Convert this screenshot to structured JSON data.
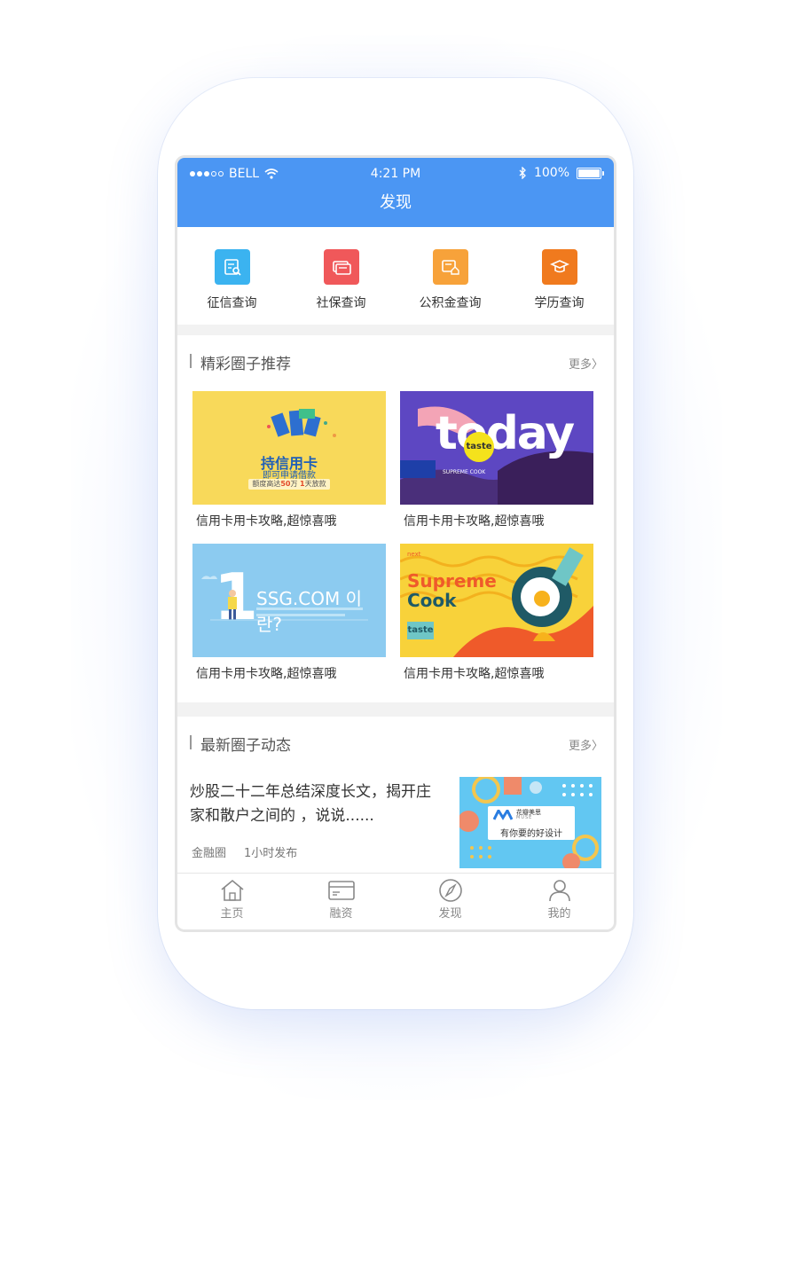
{
  "status_bar": {
    "carrier": "BELL",
    "time": "4:21 PM",
    "battery": "100%"
  },
  "nav": {
    "title": "发现"
  },
  "quick_actions": [
    {
      "label": "征信查询",
      "color": "#3bb3f0",
      "icon": "credit-report-icon"
    },
    {
      "label": "社保查询",
      "color": "#f0585a",
      "icon": "social-security-card-icon"
    },
    {
      "label": "公积金查询",
      "color": "#f7a23a",
      "icon": "housing-fund-icon"
    },
    {
      "label": "学历查询",
      "color": "#f07a1e",
      "icon": "graduation-cap-icon"
    }
  ],
  "circles": {
    "title": "精彩圈子推荐",
    "more": "更多〉",
    "cards": [
      {
        "caption": "信用卡用卡攻略,超惊喜哦",
        "img_title": "持信用卡",
        "img_sub": "即可申请借款",
        "img_note_a": "额度高达",
        "img_note_b": "50",
        "img_note_c": "万",
        "img_note_d": "1",
        "img_note_e": "天放款"
      },
      {
        "caption": "信用卡用卡攻略,超惊喜哦",
        "img_big": "today",
        "img_badge": "taste",
        "img_small": "SUPREME COOK"
      },
      {
        "caption": "信用卡用卡攻略,超惊喜哦",
        "img_num": "1",
        "img_title": "SSG.COM 이란?"
      },
      {
        "caption": "信用卡用卡攻略,超惊喜哦",
        "img_tag": "next",
        "img_l1": "Supreme",
        "img_l2": "Cook",
        "img_badge": "taste"
      }
    ]
  },
  "news": {
    "title": "最新圈子动态",
    "more": "更多〉",
    "item": {
      "headline": "炒股二十二年总结深度长文，揭开庄家和散户之间的 ，说说......",
      "tag": "金融圈",
      "time": "1小时发布",
      "img_brand": "花瓣美思",
      "img_brand_en": "MUSE",
      "img_slogan": "有你要的好设计"
    }
  },
  "tabs": [
    {
      "label": "主页",
      "icon": "home-icon"
    },
    {
      "label": "融资",
      "icon": "card-icon"
    },
    {
      "label": "发现",
      "icon": "compass-icon"
    },
    {
      "label": "我的",
      "icon": "user-icon"
    }
  ]
}
